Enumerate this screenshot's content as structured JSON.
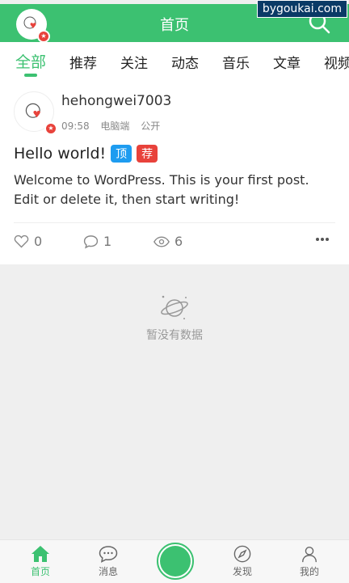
{
  "header": {
    "title": "首页",
    "site_tag": "bygoukai.com"
  },
  "tabs": [
    "全部",
    "推荐",
    "关注",
    "动态",
    "音乐",
    "文章",
    "视频"
  ],
  "post": {
    "author": "hehongwei7003",
    "time": "09:58",
    "device": "电脑端",
    "visibility": "公开",
    "title": "Hello world!",
    "tags": [
      "顶",
      "荐"
    ],
    "excerpt": "Welcome to WordPress. This is your first post. Edit or delete it, then start writing!",
    "likes": "0",
    "comments": "1",
    "views": "6"
  },
  "empty_state": {
    "text": "暂没有数据"
  },
  "bottom_nav": {
    "home": "首页",
    "messages": "消息",
    "discover": "发现",
    "mine": "我的"
  },
  "colors": {
    "accent": "#3cc171",
    "badge_red": "#e8423b",
    "tag_blue": "#1e9cf0"
  }
}
